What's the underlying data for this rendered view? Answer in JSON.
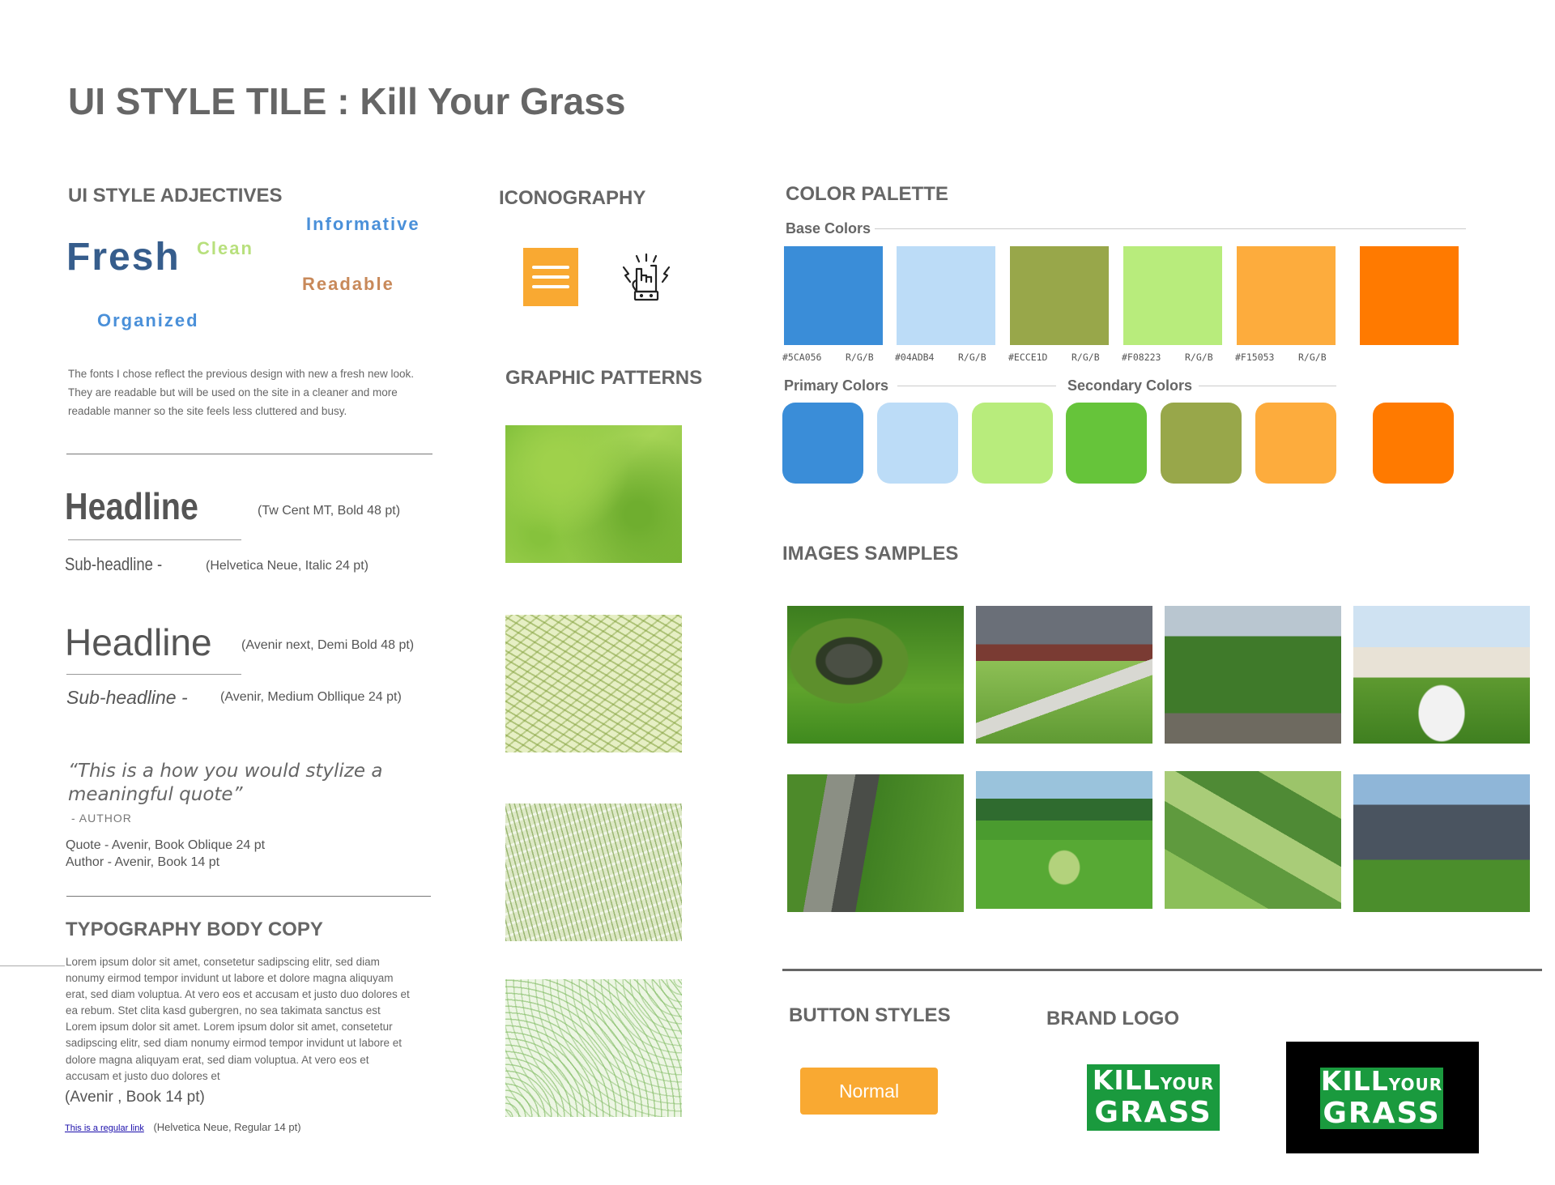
{
  "title": "UI STYLE TILE : Kill Your Grass",
  "adjectives": {
    "heading": "UI STYLE ADJECTIVES",
    "fresh": "Fresh",
    "clean": "Clean",
    "informative": "Informative",
    "readable": "Readable",
    "organized": "Organized",
    "description": "The fonts I chose reflect the previous design with new a fresh new look. They are readable but will be used on the site in a cleaner and more readable manner so the site feels less cluttered and busy.",
    "colors": {
      "fresh": "#365d8c",
      "clean": "#b8e07d",
      "informative": "#4a90d9",
      "readable": "#c8895a",
      "organized": "#4a90d9"
    }
  },
  "typography": {
    "headline1": "Headline",
    "headline1_note": "(Tw Cent MT, Bold 48 pt)",
    "sub1": "Sub-headline -",
    "sub1_note": "(Helvetica Neue, Italic 24 pt)",
    "headline2": "Headline",
    "headline2_note": "(Avenir next, Demi Bold 48 pt)",
    "sub2": "Sub-headline -",
    "sub2_note": "(Avenir, Medium Obllique 24 pt)",
    "quote": "“This is a how you would stylize a meaningful quote”",
    "author": "- AUTHOR",
    "quote_note": "Quote - Avenir, Book Oblique 24 pt",
    "author_note": "Author - Avenir, Book 14 pt"
  },
  "body_copy": {
    "heading": "TYPOGRAPHY BODY COPY",
    "text": "Lorem ipsum dolor sit amet, consetetur sadipscing elitr, sed diam nonumy eirmod tempor invidunt ut labore et dolore magna aliquyam erat, sed diam voluptua. At vero eos et accusam et justo duo dolores et ea rebum. Stet clita kasd gubergren, no sea takimata sanctus est Lorem ipsum dolor sit amet. Lorem ipsum dolor sit amet, consetetur sadipscing elitr, sed diam nonumy eirmod tempor invidunt ut labore et dolore magna aliquyam erat, sed diam voluptua. At vero eos et accusam et justo duo dolores et",
    "font_note": "(Avenir , Book 14 pt)",
    "link_text": "This is a regular link",
    "link_note": "(Helvetica Neue, Regular 14 pt)"
  },
  "iconography": {
    "heading": "ICONOGRAPHY",
    "icons": [
      "menu-icon",
      "rock-hand-icon"
    ]
  },
  "patterns": {
    "heading": "GRAPHIC PATTERNS"
  },
  "palette": {
    "heading": "COLOR PALETTE",
    "base_label": "Base Colors",
    "base_colors": [
      "#3a8dd8",
      "#bcdcf7",
      "#98a74a",
      "#b8ec7c",
      "#fdac3d",
      "#ff7a00"
    ],
    "codes": [
      {
        "hex": "#5CA056",
        "rgb": "R/G/B"
      },
      {
        "hex": "#04ADB4",
        "rgb": "R/G/B"
      },
      {
        "hex": "#ECCE1D",
        "rgb": "R/G/B"
      },
      {
        "hex": "#F08223",
        "rgb": "R/G/B"
      },
      {
        "hex": "#F15053",
        "rgb": "R/G/B"
      }
    ],
    "primary_label": "Primary Colors",
    "secondary_label": "Secondary Colors",
    "primary_colors": [
      "#3a8dd8",
      "#bcdcf7",
      "#b8ec7c"
    ],
    "secondary_colors": [
      "#66c43a",
      "#98a74a",
      "#fdac3d",
      "#ff7a00"
    ]
  },
  "images": {
    "heading": "IMAGES SAMPLES"
  },
  "buttons": {
    "heading": "BUTTON STYLES",
    "normal": "Normal"
  },
  "brand": {
    "heading": "BRAND LOGO",
    "logo_line1": "KILL",
    "logo_small": "YOUR",
    "logo_line2": "GRASS"
  }
}
